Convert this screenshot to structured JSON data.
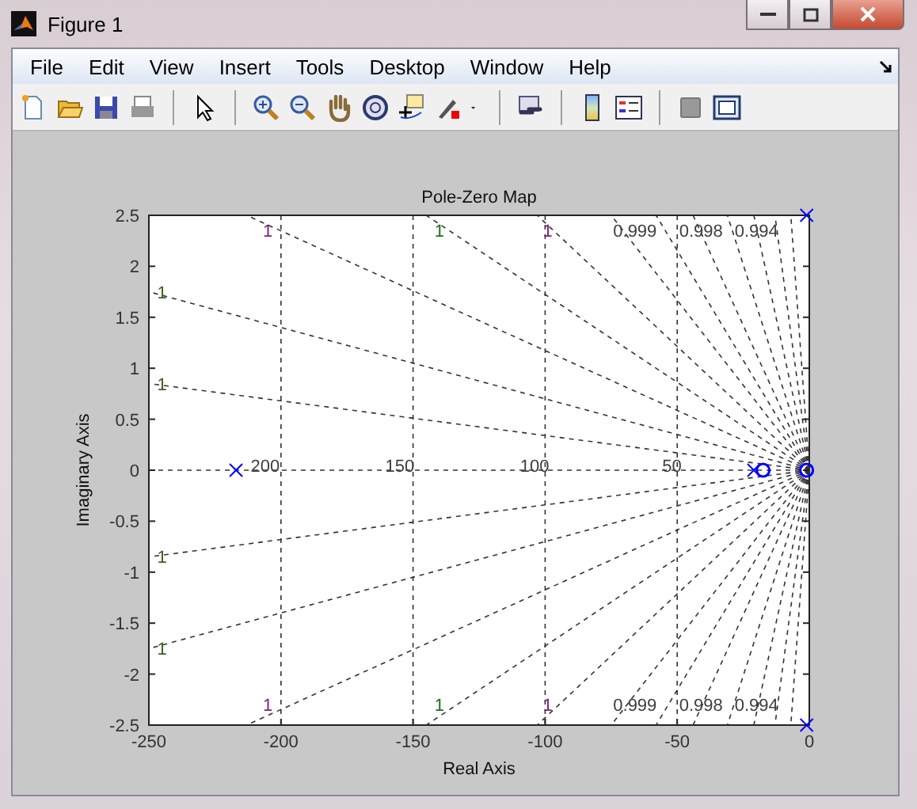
{
  "window": {
    "title": "Figure 1"
  },
  "menu": [
    {
      "label": "File"
    },
    {
      "label": "Edit"
    },
    {
      "label": "View"
    },
    {
      "label": "Insert"
    },
    {
      "label": "Tools"
    },
    {
      "label": "Desktop"
    },
    {
      "label": "Window"
    },
    {
      "label": "Help"
    }
  ],
  "figure": {
    "chart_data": {
      "type": "scatter",
      "title": "Pole-Zero Map",
      "xlabel": "Real Axis",
      "ylabel": "Imaginary Axis",
      "xlim": [
        -250,
        0
      ],
      "ylim": [
        -2.5,
        2.5
      ],
      "xticks": [
        -250,
        -200,
        -150,
        -100,
        -50,
        0
      ],
      "yticks": [
        -2.5,
        -2,
        -1.5,
        -1,
        -0.5,
        0,
        0.5,
        1,
        1.5,
        2,
        2.5
      ],
      "grid": true,
      "x": [
        -217,
        -21,
        -17.5,
        -1,
        -1,
        -1
      ],
      "series": [
        {
          "color": "#0000ff",
          "values": [
            0,
            0,
            null,
            2.5,
            -2.5,
            null
          ]
        },
        {
          "color": "#0000ff",
          "values": [
            null,
            null,
            0,
            null,
            null,
            0
          ]
        }
      ],
      "annotations": [
        "1",
        "1",
        "1",
        "0.999",
        "0.998",
        "0.994",
        "1",
        "1",
        "200",
        "150",
        "100",
        "50",
        "1",
        "1",
        "1",
        "1",
        "1",
        "0.999",
        "0.998",
        "0.994"
      ]
    }
  }
}
